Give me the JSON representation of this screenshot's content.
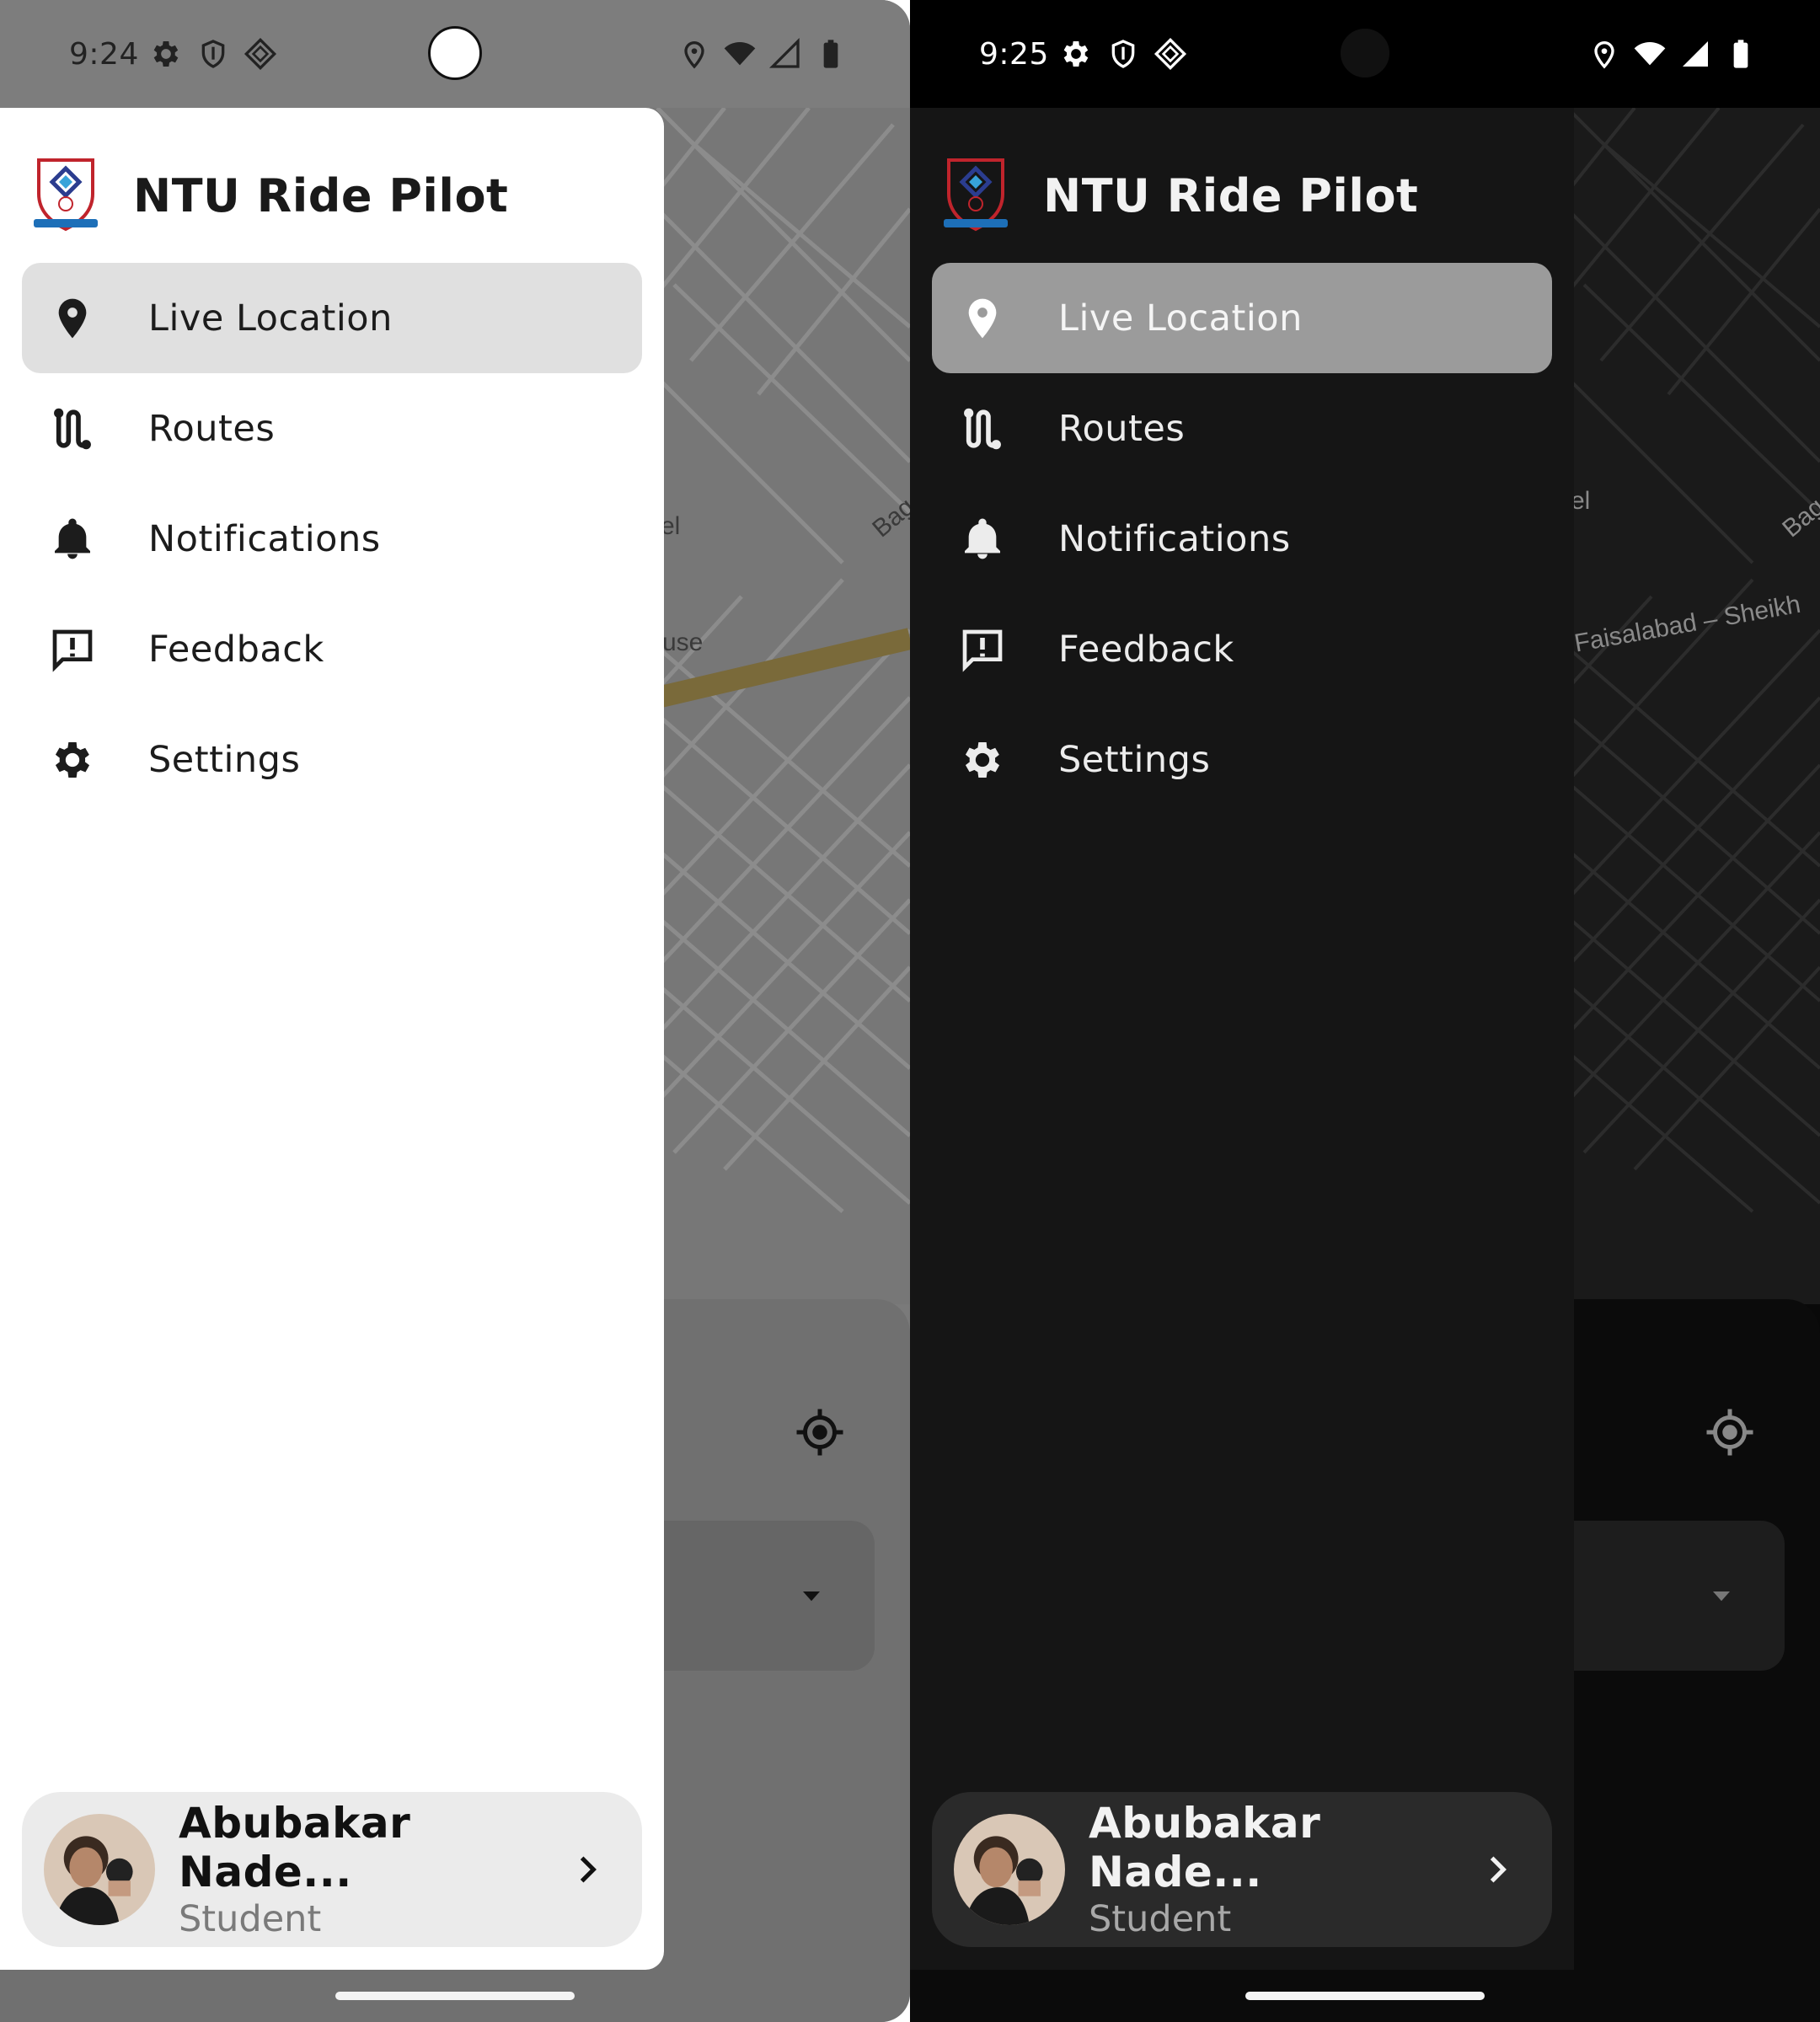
{
  "light": {
    "status": {
      "time": "9:24"
    },
    "map": {
      "labels": [
        "el",
        "use",
        "Bag"
      ]
    },
    "drawer": {
      "title": "NTU Ride Pilot",
      "items": [
        {
          "label": "Live Location",
          "icon": "location-pin-icon",
          "active": true
        },
        {
          "label": "Routes",
          "icon": "route-icon",
          "active": false
        },
        {
          "label": "Notifications",
          "icon": "bell-icon",
          "active": false
        },
        {
          "label": "Feedback",
          "icon": "feedback-icon",
          "active": false
        },
        {
          "label": "Settings",
          "icon": "gear-icon",
          "active": false
        }
      ],
      "profile": {
        "name": "Abubakar Nade...",
        "role": "Student"
      }
    }
  },
  "dark": {
    "status": {
      "time": "9:25"
    },
    "map": {
      "labels": [
        "el",
        "Faisalabad – Sheikh",
        "Bag"
      ]
    },
    "drawer": {
      "title": "NTU Ride Pilot",
      "items": [
        {
          "label": "Live Location",
          "icon": "location-pin-icon",
          "active": true
        },
        {
          "label": "Routes",
          "icon": "route-icon",
          "active": false
        },
        {
          "label": "Notifications",
          "icon": "bell-icon",
          "active": false
        },
        {
          "label": "Feedback",
          "icon": "feedback-icon",
          "active": false
        },
        {
          "label": "Settings",
          "icon": "gear-icon",
          "active": false
        }
      ],
      "profile": {
        "name": "Abubakar Nade...",
        "role": "Student"
      }
    }
  },
  "colors": {
    "light_drawer_bg": "#ffffff",
    "light_active_bg": "#e0e0e0",
    "dark_drawer_bg": "#151515",
    "dark_active_bg": "#9b9b9b",
    "map_road": "#7a6a3a"
  }
}
